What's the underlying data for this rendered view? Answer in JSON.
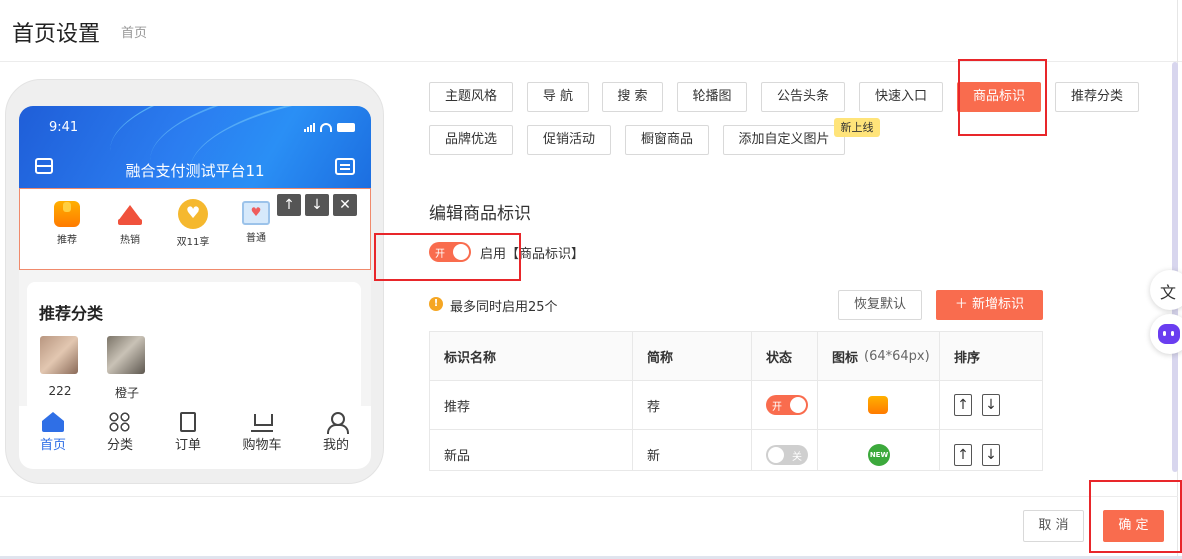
{
  "header": {
    "title": "首页设置",
    "breadcrumb": "首页"
  },
  "phone": {
    "time": "9:41",
    "store_name": "融合支付测试平台11",
    "tags": [
      {
        "label": "推荐",
        "icon": "thumbs-up-icon"
      },
      {
        "label": "热销",
        "icon": "crown-icon"
      },
      {
        "label": "双11享",
        "icon": "heart-badge-icon"
      },
      {
        "label": "普通",
        "icon": "card-heart-icon"
      }
    ],
    "controls": [
      "↑",
      "↓",
      "✕"
    ],
    "recommend": {
      "title": "推荐分类",
      "items": [
        {
          "label": "222"
        },
        {
          "label": "橙子"
        }
      ]
    },
    "tabbar": [
      {
        "label": "首页",
        "icon": "home-icon",
        "active": true
      },
      {
        "label": "分类",
        "icon": "grid-icon"
      },
      {
        "label": "订单",
        "icon": "order-icon"
      },
      {
        "label": "购物车",
        "icon": "cart-icon"
      },
      {
        "label": "我的",
        "icon": "user-icon"
      }
    ]
  },
  "modules": {
    "row1": [
      "主题风格",
      "导 航",
      "搜 索",
      "轮播图",
      "公告头条",
      "快速入口",
      "商品标识",
      "推荐分类"
    ],
    "row2": [
      "品牌优选",
      "促销活动",
      "橱窗商品",
      "添加自定义图片"
    ],
    "active": "商品标识",
    "new_badge": "新上线"
  },
  "editor": {
    "title": "编辑商品标识",
    "switch_on_text": "开",
    "enable_label": "启用【商品标识】",
    "limit_text": "最多同时启用25个",
    "reset_button": "恢复默认",
    "add_button": "＋ 新增标识",
    "table": {
      "headers": {
        "name": "标识名称",
        "short": "简称",
        "status": "状态",
        "icon": "图标",
        "icon_hint": "(64*64px)",
        "sort": "排序"
      },
      "rows": [
        {
          "name": "推荐",
          "short": "荐",
          "status": "开",
          "enabled": true,
          "icon": "thumbs-up-icon"
        },
        {
          "name": "新品",
          "short": "新",
          "status": "关",
          "enabled": false,
          "icon": "new-badge-icon",
          "icon_text": "NEW"
        }
      ]
    }
  },
  "footer": {
    "cancel": "取 消",
    "confirm": "确 定"
  },
  "colors": {
    "accent": "#f96c4e",
    "phone_header": "#2b7df0",
    "annotation": "#e8262a"
  }
}
